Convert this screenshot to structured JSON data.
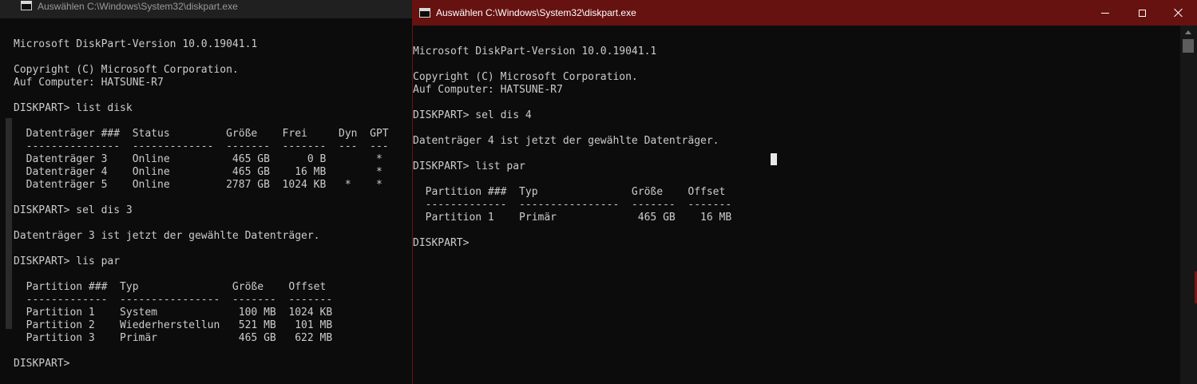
{
  "left_window": {
    "title": "Auswählen C:\\Windows\\System32\\diskpart.exe",
    "console_text": "\nMicrosoft DiskPart-Version 10.0.19041.1\n\nCopyright (C) Microsoft Corporation.\nAuf Computer: HATSUNE-R7\n\nDISKPART> list disk\n\n  Datenträger ###  Status         Größe    Frei     Dyn  GPT\n  ---------------  -------------  -------  -------  ---  ---\n  Datenträger 3    Online          465 GB      0 B        *\n  Datenträger 4    Online          465 GB    16 MB        *\n  Datenträger 5    Online         2787 GB  1024 KB   *    *\n\nDISKPART> sel dis 3\n\nDatenträger 3 ist jetzt der gewählte Datenträger.\n\nDISKPART> lis par\n\n  Partition ###  Typ               Größe    Offset\n  -------------  ----------------  -------  -------\n  Partition 1    System             100 MB  1024 KB\n  Partition 2    Wiederherstellun   521 MB   101 MB\n  Partition 3    Primär             465 GB   622 MB\n\nDISKPART> "
  },
  "right_window": {
    "title": "Auswählen C:\\Windows\\System32\\diskpart.exe",
    "console_text": "\nMicrosoft DiskPart-Version 10.0.19041.1\n\nCopyright (C) Microsoft Corporation.\nAuf Computer: HATSUNE-R7\n\nDISKPART> sel dis 4\n\nDatenträger 4 ist jetzt der gewählte Datenträger.\n\nDISKPART> list par\n\n  Partition ###  Typ               Größe    Offset\n  -------------  ----------------  -------  -------\n  Partition 1    Primär             465 GB    16 MB\n\nDISKPART> "
  },
  "colors": {
    "console_background": "#0c0c0c",
    "console_text": "#cccccc",
    "active_titlebar": "#661210",
    "inactive_titlebar": "#202020"
  }
}
